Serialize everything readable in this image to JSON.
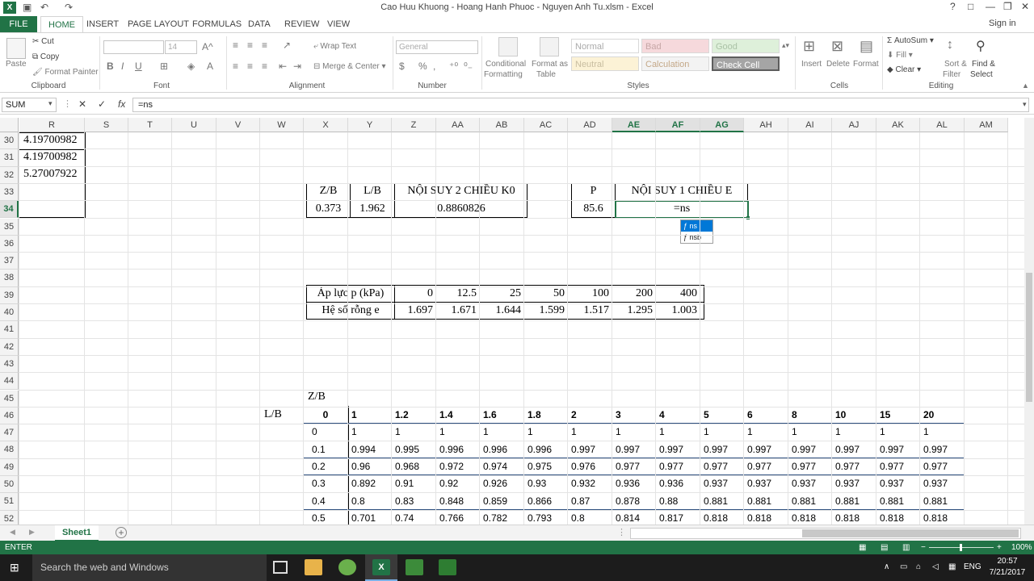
{
  "title": "Cao Huu Khuong - Hoang Hanh Phuoc - Nguyen Anh Tu.xlsm - Excel",
  "window": {
    "help": "?",
    "restore": "□",
    "minimize": "—",
    "maximize": "❐",
    "close": "✕",
    "sign_in": "Sign in"
  },
  "tabs": [
    "FILE",
    "HOME",
    "INSERT",
    "PAGE LAYOUT",
    "FORMULAS",
    "DATA",
    "REVIEW",
    "VIEW"
  ],
  "ribbon": {
    "clipboard": {
      "paste": "Paste",
      "cut": "Cut",
      "copy": "Copy",
      "format_painter": "Format Painter",
      "label": "Clipboard"
    },
    "font": {
      "size": "14",
      "label": "Font",
      "bold": "B",
      "italic": "I",
      "underline": "U"
    },
    "alignment": {
      "wrap": "Wrap Text",
      "merge": "Merge & Center",
      "label": "Alignment"
    },
    "number": {
      "format": "General",
      "label": "Number",
      "currency": "$",
      "percent": "%",
      "comma": ","
    },
    "styles": {
      "cond": "Conditional",
      "cond2": "Formatting",
      "fmt_table": "Format as",
      "fmt_table2": "Table",
      "normal": "Normal",
      "bad": "Bad",
      "good": "Good",
      "neutral": "Neutral",
      "calculation": "Calculation",
      "check_cell": "Check Cell",
      "label": "Styles"
    },
    "cells": {
      "insert": "Insert",
      "delete": "Delete",
      "format": "Format",
      "label": "Cells"
    },
    "editing": {
      "autosum": "AutoSum",
      "fill": "Fill",
      "clear": "Clear",
      "sort": "Sort &",
      "sort2": "Filter",
      "find": "Find &",
      "find2": "Select",
      "label": "Editing"
    }
  },
  "formula_bar": {
    "name_box": "SUM",
    "cancel": "✕",
    "enter": "✓",
    "fx": "fx",
    "formula": "=ns"
  },
  "columns": [
    {
      "l": "R",
      "w": 81
    },
    {
      "l": "S",
      "w": 54
    },
    {
      "l": "T",
      "w": 54
    },
    {
      "l": "U",
      "w": 55
    },
    {
      "l": "V",
      "w": 54
    },
    {
      "l": "W",
      "w": 54
    },
    {
      "l": "X",
      "w": 55
    },
    {
      "l": "Y",
      "w": 54
    },
    {
      "l": "Z",
      "w": 55
    },
    {
      "l": "AA",
      "w": 54
    },
    {
      "l": "AB",
      "w": 55
    },
    {
      "l": "AC",
      "w": 54
    },
    {
      "l": "AD",
      "w": 55
    },
    {
      "l": "AE",
      "w": 54
    },
    {
      "l": "AF",
      "w": 55
    },
    {
      "l": "AG",
      "w": 54
    },
    {
      "l": "AH",
      "w": 55
    },
    {
      "l": "AI",
      "w": 54
    },
    {
      "l": "AJ",
      "w": 55
    },
    {
      "l": "AK",
      "w": 54
    },
    {
      "l": "AL",
      "w": 55
    },
    {
      "l": "AM",
      "w": 54
    }
  ],
  "rows": [
    "30",
    "31",
    "32",
    "33",
    "34",
    "35",
    "36",
    "37",
    "38",
    "39",
    "40",
    "41",
    "42",
    "43",
    "44",
    "45",
    "46",
    "47",
    "48",
    "49",
    "50",
    "51",
    "52"
  ],
  "col_r_values": [
    "4.19700982",
    "4.19700982",
    "5.27007922"
  ],
  "interp2": {
    "h1": "Z/B",
    "h2": "L/B",
    "h3": "NỘI SUY 2 CHIỀU K0",
    "v1": "0.373",
    "v2": "1.962",
    "v3": "0.8860826"
  },
  "interp1": {
    "h1": "P",
    "h2": "NỘI SUY 1 CHIỀU E",
    "v1": "85.6",
    "v2": "=ns"
  },
  "autocomplete": [
    "ns",
    "nsb"
  ],
  "pressure": {
    "label1": "Áp lực p (kPa)",
    "label2": "Hệ số rỗng e",
    "p": [
      "0",
      "12.5",
      "25",
      "50",
      "100",
      "200",
      "400"
    ],
    "e": [
      "1.697",
      "1.671",
      "1.644",
      "1.599",
      "1.517",
      "1.295",
      "1.003"
    ]
  },
  "k_table": {
    "zb_label": "Z/B",
    "lb_label": "L/B",
    "header": [
      "0",
      "1",
      "1.2",
      "1.4",
      "1.6",
      "1.8",
      "2",
      "3",
      "4",
      "5",
      "6",
      "8",
      "10",
      "15",
      "20"
    ],
    "rows": [
      [
        "0",
        "1",
        "1",
        "1",
        "1",
        "1",
        "1",
        "1",
        "1",
        "1",
        "1",
        "1",
        "1",
        "1",
        "1"
      ],
      [
        "0.1",
        "0.994",
        "0.995",
        "0.996",
        "0.996",
        "0.996",
        "0.997",
        "0.997",
        "0.997",
        "0.997",
        "0.997",
        "0.997",
        "0.997",
        "0.997",
        "0.997"
      ],
      [
        "0.2",
        "0.96",
        "0.968",
        "0.972",
        "0.974",
        "0.975",
        "0.976",
        "0.977",
        "0.977",
        "0.977",
        "0.977",
        "0.977",
        "0.977",
        "0.977",
        "0.977"
      ],
      [
        "0.3",
        "0.892",
        "0.91",
        "0.92",
        "0.926",
        "0.93",
        "0.932",
        "0.936",
        "0.936",
        "0.937",
        "0.937",
        "0.937",
        "0.937",
        "0.937",
        "0.937"
      ],
      [
        "0.4",
        "0.8",
        "0.83",
        "0.848",
        "0.859",
        "0.866",
        "0.87",
        "0.878",
        "0.88",
        "0.881",
        "0.881",
        "0.881",
        "0.881",
        "0.881",
        "0.881"
      ],
      [
        "0.5",
        "0.701",
        "0.74",
        "0.766",
        "0.782",
        "0.793",
        "0.8",
        "0.814",
        "0.817",
        "0.818",
        "0.818",
        "0.818",
        "0.818",
        "0.818",
        "0.818"
      ]
    ]
  },
  "sheet_tab": "Sheet1",
  "status": {
    "mode": "ENTER",
    "zoom": "100%"
  },
  "taskbar": {
    "search": "Search the web and Windows",
    "lang": "ENG",
    "time": "20:57",
    "date": "7/21/2017"
  },
  "colors": {
    "excel_green": "#217346",
    "table_blue": "#2e4f7f"
  }
}
